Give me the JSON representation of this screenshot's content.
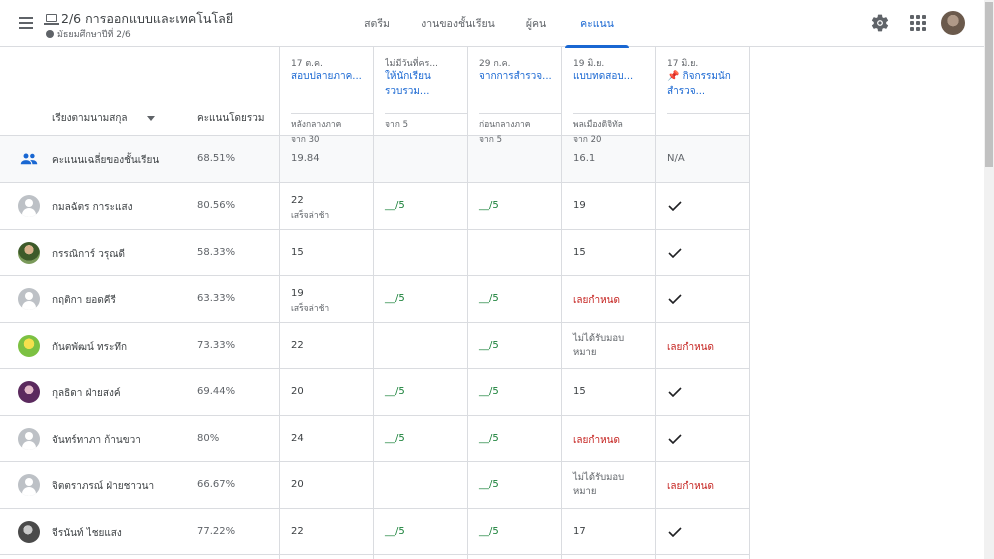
{
  "header": {
    "class_title": "2/6 การออกแบบและเทคโนโลยี",
    "class_subtitle": "มัธยมศึกษาปีที่ 2/6",
    "tabs": [
      {
        "label": "สตรีม",
        "active": false
      },
      {
        "label": "งานของชั้นเรียน",
        "active": false
      },
      {
        "label": "ผู้คน",
        "active": false
      },
      {
        "label": "คะแนน",
        "active": true
      }
    ]
  },
  "gradebook": {
    "sort_label": "เรียงตามนามสกุล",
    "overall_label": "คะแนนโดยรวม",
    "assignments": [
      {
        "date": "17 ต.ค.",
        "title": "สอบปลายภาค...",
        "category": "หลังกลางภาค",
        "points": "จาก 30"
      },
      {
        "date": "ไม่มีวันที่คร...",
        "title": "ให้นักเรียนรวบรวม...",
        "category": "",
        "points": "จาก 5"
      },
      {
        "date": "29 ก.ค.",
        "title": "จากการสำรวจ...",
        "category": "ก่อนกลางภาค",
        "points": "จาก 5"
      },
      {
        "date": "19 มิ.ย.",
        "title": "แบบทดสอบ...",
        "category": "พลเมืองดิจิทัล",
        "points": "จาก 20"
      },
      {
        "date": "17 มิ.ย.",
        "title": "📌 กิจกรรมนักสำรวจ...",
        "category": "",
        "points": ""
      }
    ],
    "average_row": {
      "label": "คะแนนเฉลี่ยของชั้นเรียน",
      "overall": "68.51%",
      "grades": [
        "19.84",
        "",
        "",
        "16.1",
        "N/A"
      ]
    },
    "students": [
      {
        "name": "กมลฉัตร การะแสง",
        "overall": "80.56%",
        "grades": [
          {
            "v": "22",
            "note": "เสร็จล่าช้า"
          },
          {
            "v": "__/5",
            "s": "green"
          },
          {
            "v": "__/5",
            "s": "green"
          },
          {
            "v": "19"
          },
          {
            "check": true
          }
        ]
      },
      {
        "name": "กรรณิการ์ วรุณดี",
        "overall": "58.33%",
        "grades": [
          {
            "v": "15"
          },
          {
            "v": ""
          },
          {
            "v": ""
          },
          {
            "v": "15"
          },
          {
            "check": true
          }
        ]
      },
      {
        "name": "กฤติกา ยอดคีรี",
        "overall": "63.33%",
        "grades": [
          {
            "v": "19",
            "note": "เสร็จล่าช้า"
          },
          {
            "v": "__/5",
            "s": "green"
          },
          {
            "v": "__/5",
            "s": "green"
          },
          {
            "v": "เลยกำหนด",
            "s": "red"
          },
          {
            "check": true
          }
        ]
      },
      {
        "name": "กันตพัฒน์ ทระทึก",
        "overall": "73.33%",
        "grades": [
          {
            "v": "22"
          },
          {
            "v": ""
          },
          {
            "v": "__/5",
            "s": "green"
          },
          {
            "v": "ไม่ได้รับมอบหมาย",
            "s": "wrap"
          },
          {
            "v": "เลยกำหนด",
            "s": "red"
          }
        ]
      },
      {
        "name": "กุลธิดา ฝ่ายสงค์",
        "overall": "69.44%",
        "grades": [
          {
            "v": "20"
          },
          {
            "v": "__/5",
            "s": "green"
          },
          {
            "v": "__/5",
            "s": "green"
          },
          {
            "v": "15"
          },
          {
            "check": true
          }
        ]
      },
      {
        "name": "จันทร์ทาภา ก้านขวา",
        "overall": "80%",
        "grades": [
          {
            "v": "24"
          },
          {
            "v": "__/5",
            "s": "green"
          },
          {
            "v": "__/5",
            "s": "green"
          },
          {
            "v": "เลยกำหนด",
            "s": "red"
          },
          {
            "check": true
          }
        ]
      },
      {
        "name": "จิตตราภรณ์ ฝ่ายชาวนา",
        "overall": "66.67%",
        "grades": [
          {
            "v": "20"
          },
          {
            "v": ""
          },
          {
            "v": "__/5",
            "s": "green"
          },
          {
            "v": "ไม่ได้รับมอบหมาย",
            "s": "wrap"
          },
          {
            "v": "เลยกำหนด",
            "s": "red"
          }
        ]
      },
      {
        "name": "จีรนันท์ ไชยแสง",
        "overall": "77.22%",
        "grades": [
          {
            "v": "22"
          },
          {
            "v": "__/5",
            "s": "green"
          },
          {
            "v": "__/5",
            "s": "green"
          },
          {
            "v": "17"
          },
          {
            "check": true
          }
        ]
      }
    ]
  },
  "icons": {
    "menu": "hamburger-icon",
    "class": "laptop-icon",
    "subtitle": "people-icon",
    "settings": "gear-icon",
    "apps": "apps-grid-icon",
    "group": "group-icon",
    "check": "check-icon"
  },
  "colors": {
    "accent": "#1967d2",
    "green": "#188038",
    "red": "#c5221f"
  }
}
